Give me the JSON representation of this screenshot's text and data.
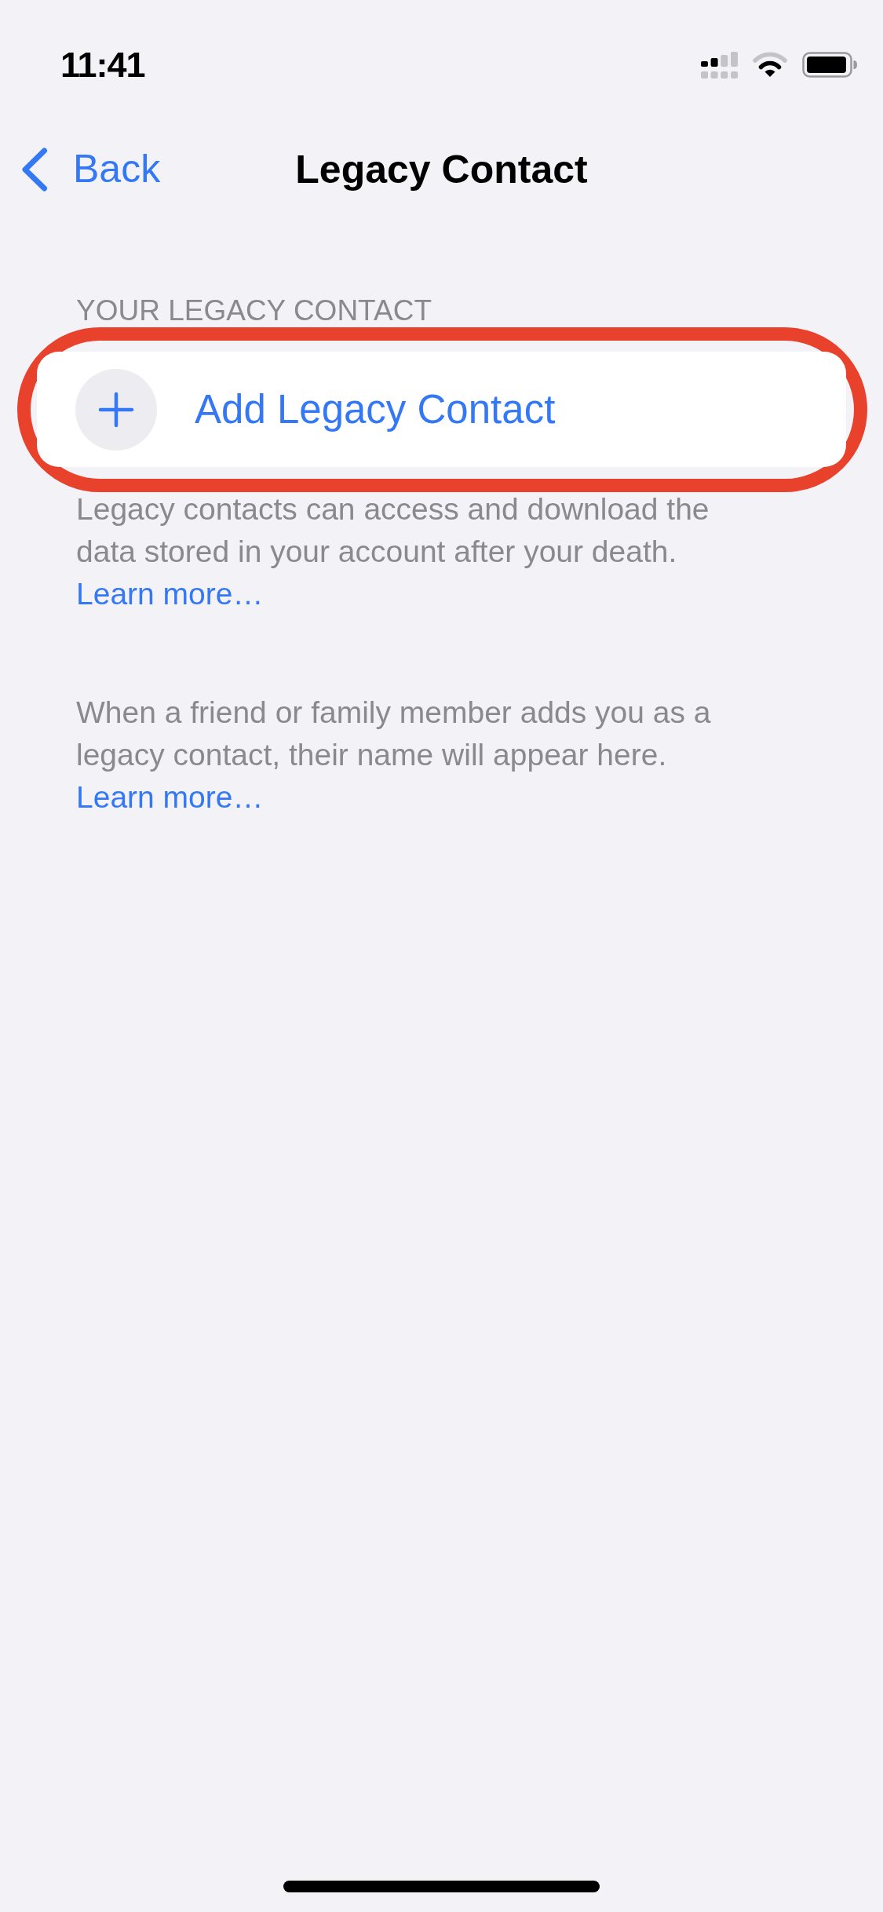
{
  "status_bar": {
    "time": "11:41"
  },
  "nav_bar": {
    "back_label": "Back",
    "title": "Legacy Contact"
  },
  "sections": [
    {
      "header": "YOUR LEGACY CONTACT",
      "rows": [
        {
          "kind": "add",
          "label": "Add Legacy Contact",
          "highlighted": true
        }
      ],
      "footer": {
        "text": "Legacy contacts can access and download the data stored in your account after your death.",
        "link": "Learn more…"
      }
    }
  ],
  "notes": [
    {
      "text": "When a friend or family member adds you as a legacy contact, their name will appear here.",
      "link": "Learn more…"
    }
  ]
}
